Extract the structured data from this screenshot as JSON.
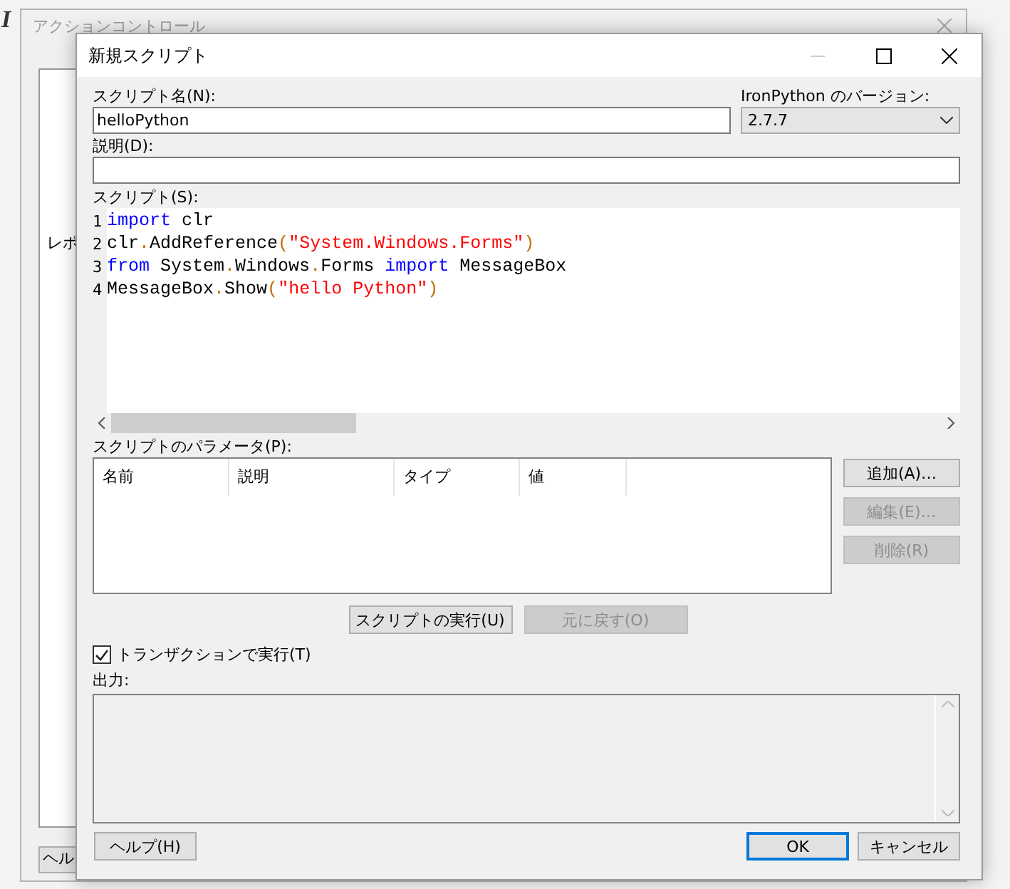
{
  "desktop_glyph": "I",
  "background_window": {
    "title": "アクションコントロール",
    "side_text": "レポ",
    "button": "ヘル"
  },
  "dialog": {
    "title": "新規スクリプト",
    "name_label": "スクリプト名(N):",
    "name_value": "helloPython",
    "version_label": "IronPython のバージョン:",
    "version_value": "2.7.7",
    "description_label": "説明(D):",
    "script_label": "スクリプト(S):",
    "script_lines": [
      {
        "number": "1",
        "tokens": [
          {
            "text": "import",
            "kind": "keyword"
          },
          {
            "text": " clr",
            "kind": "plain"
          }
        ]
      },
      {
        "number": "2",
        "tokens": [
          {
            "text": "clr",
            "kind": "plain"
          },
          {
            "text": ".",
            "kind": "operator"
          },
          {
            "text": "AddReference",
            "kind": "plain"
          },
          {
            "text": "(",
            "kind": "operator"
          },
          {
            "text": "\"System.Windows.Forms\"",
            "kind": "string"
          },
          {
            "text": ")",
            "kind": "operator"
          }
        ]
      },
      {
        "number": "3",
        "tokens": [
          {
            "text": "from",
            "kind": "keyword"
          },
          {
            "text": " System",
            "kind": "plain"
          },
          {
            "text": ".",
            "kind": "operator"
          },
          {
            "text": "Windows",
            "kind": "plain"
          },
          {
            "text": ".",
            "kind": "operator"
          },
          {
            "text": "Forms ",
            "kind": "plain"
          },
          {
            "text": "import",
            "kind": "keyword"
          },
          {
            "text": " MessageBox",
            "kind": "plain"
          }
        ]
      },
      {
        "number": "4",
        "tokens": [
          {
            "text": "MessageBox",
            "kind": "plain"
          },
          {
            "text": ".",
            "kind": "operator"
          },
          {
            "text": "Show",
            "kind": "plain"
          },
          {
            "text": "(",
            "kind": "operator"
          },
          {
            "text": "\"hello Python\"",
            "kind": "string"
          },
          {
            "text": ")",
            "kind": "operator"
          }
        ]
      }
    ],
    "parameters_label": "スクリプトのパラメータ(P):",
    "parameter_columns": [
      "名前",
      "説明",
      "タイプ",
      "値"
    ],
    "parameter_buttons": [
      {
        "label": "追加(A)…",
        "disabled": false
      },
      {
        "label": "編集(E)…",
        "disabled": true
      },
      {
        "label": "削除(R)",
        "disabled": true
      }
    ],
    "run_buttons": [
      {
        "label": "スクリプトの実行(U)",
        "disabled": false
      },
      {
        "label": "元に戻す(O)",
        "disabled": true
      }
    ],
    "transaction": {
      "label": "トランザクションで実行(T)",
      "checked": true
    },
    "output_label": "出力:",
    "buttons": [
      {
        "label": "ヘルプ(H)",
        "default": false
      },
      {
        "label": "OK",
        "default": true
      },
      {
        "label": "キャンセル",
        "default": false
      }
    ]
  }
}
